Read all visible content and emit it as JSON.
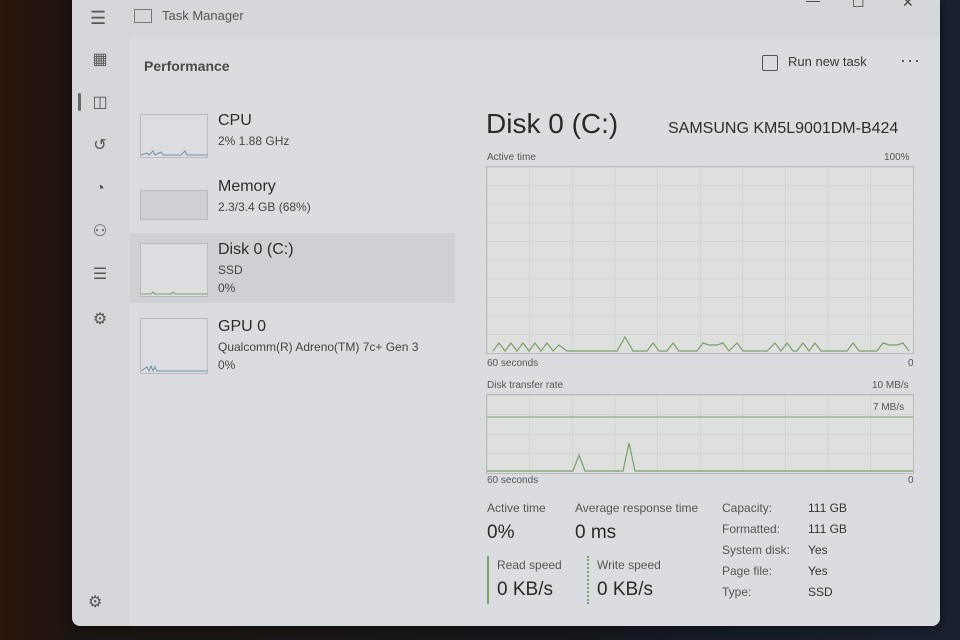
{
  "app": {
    "title": "Task Manager"
  },
  "header": {
    "section_title": "Performance",
    "run_new_task": "Run new task",
    "more": "···"
  },
  "nav_icons": [
    "processes-icon",
    "performance-icon",
    "app-history-icon",
    "startup-icon",
    "users-icon",
    "details-icon",
    "services-icon"
  ],
  "sidebar": {
    "cpu": {
      "name": "CPU",
      "sub1": "2% 1.88 GHz"
    },
    "memory": {
      "name": "Memory",
      "sub1": "2.3/3.4 GB (68%)"
    },
    "disk": {
      "name": "Disk 0 (C:)",
      "sub1": "SSD",
      "sub2": "0%"
    },
    "gpu": {
      "name": "GPU 0",
      "sub1": "Qualcomm(R) Adreno(TM) 7c+ Gen 3",
      "sub2": "0%"
    }
  },
  "detail": {
    "title": "Disk 0 (C:)",
    "model": "SAMSUNG KM5L9001DM-B424",
    "active_time_graph": {
      "label": "Active time",
      "max": "100%",
      "x_left": "60 seconds",
      "x_right": "0"
    },
    "transfer_graph": {
      "label": "Disk transfer rate",
      "max": "10 MB/s",
      "mid": "7 MB/s",
      "x_left": "60 seconds",
      "x_right": "0"
    },
    "stats": {
      "active_time_label": "Active time",
      "active_time_value": "0%",
      "avg_response_label": "Average response time",
      "avg_response_value": "0 ms",
      "read_label": "Read speed",
      "read_value": "0 KB/s",
      "write_label": "Write speed",
      "write_value": "0 KB/s"
    },
    "properties": [
      {
        "key": "Capacity:",
        "value": "111 GB"
      },
      {
        "key": "Formatted:",
        "value": "111 GB"
      },
      {
        "key": "System disk:",
        "value": "Yes"
      },
      {
        "key": "Page file:",
        "value": "Yes"
      },
      {
        "key": "Type:",
        "value": "SSD"
      }
    ]
  },
  "colors": {
    "graph_line": "#7aa06a",
    "window_bg": "#d6d7da"
  }
}
